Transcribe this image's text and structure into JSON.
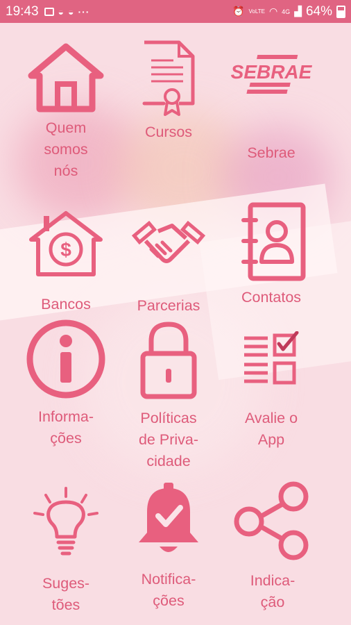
{
  "status_bar": {
    "time": "19:43",
    "battery": "64%",
    "signal_text": "4G",
    "lte_text": "VoLTE"
  },
  "menu": {
    "items": [
      {
        "label": "Quem\nsomos\nnós",
        "icon": "house-icon"
      },
      {
        "label": "Cursos",
        "icon": "certificate-icon"
      },
      {
        "label": "Sebrae",
        "icon": "sebrae-logo",
        "logo_text": "SEBRAE"
      },
      {
        "label": "Bancos",
        "icon": "bank-house-icon"
      },
      {
        "label": "Parcerias",
        "icon": "handshake-icon"
      },
      {
        "label": "Contatos",
        "icon": "contact-book-icon"
      },
      {
        "label": "Informa-\nções",
        "icon": "info-icon"
      },
      {
        "label": "Políticas\nde Priva-\ncidade",
        "icon": "lock-icon"
      },
      {
        "label": "Avalie o\nApp",
        "icon": "checklist-icon"
      },
      {
        "label": "Suges-\ntões",
        "icon": "lightbulb-icon"
      },
      {
        "label": "Notifica-\nções",
        "icon": "bell-icon"
      },
      {
        "label": "Indica-\nção",
        "icon": "share-icon"
      }
    ]
  },
  "colors": {
    "accent": "#e06482",
    "icon": "#e8607f",
    "text": "#de5b7a"
  }
}
